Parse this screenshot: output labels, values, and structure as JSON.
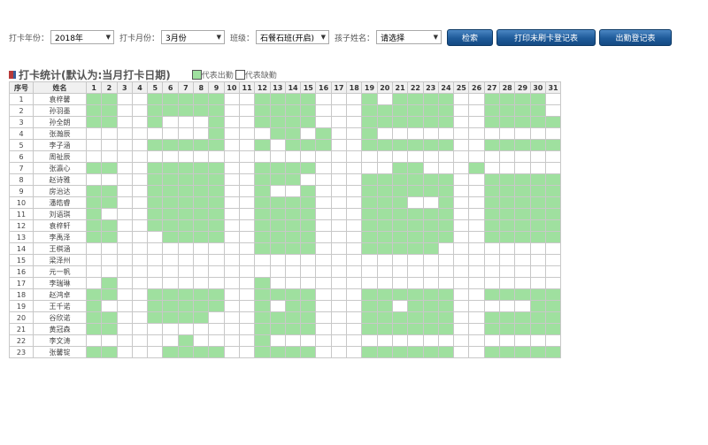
{
  "filters": {
    "year_label": "打卡年份：",
    "year_value": "2018年",
    "month_label": "打卡月份：",
    "month_value": "3月份",
    "class_label": "班级：",
    "class_value": "石餐石班(开启)",
    "child_label": "孩子姓名：",
    "child_value": "请选择"
  },
  "buttons": {
    "search": "检索",
    "print_unpunched": "打印未刷卡登记表",
    "attendance_sheet": "出勤登记表"
  },
  "section": {
    "title": "打卡统计(默认为:当月打卡日期)",
    "legend_present": "代表出勤",
    "legend_absent": "代表缺勤"
  },
  "colors": {
    "present": "#9fe09f",
    "button": "#1e5a99"
  },
  "table": {
    "header_no": "序号",
    "header_name": "姓名",
    "days": [
      "1",
      "2",
      "3",
      "4",
      "5",
      "6",
      "7",
      "8",
      "9",
      "10",
      "11",
      "12",
      "13",
      "14",
      "15",
      "16",
      "17",
      "18",
      "19",
      "20",
      "21",
      "22",
      "23",
      "24",
      "25",
      "26",
      "27",
      "28",
      "29",
      "30",
      "31"
    ],
    "rows": [
      {
        "no": "1",
        "name": "袁梓馨",
        "days": "1100111110011110001011110011110"
      },
      {
        "no": "2",
        "name": "孙羽墨",
        "days": "1100111110011110001111110011110"
      },
      {
        "no": "3",
        "name": "孙全朗",
        "days": "1100100010011110001111110011111"
      },
      {
        "no": "4",
        "name": "张瀚辰",
        "days": "0000000010001101001000000000000"
      },
      {
        "no": "5",
        "name": "李子涵",
        "days": "0000111110010111001111110011111"
      },
      {
        "no": "6",
        "name": "周祉辰",
        "days": "0000000000000000000000000000000"
      },
      {
        "no": "7",
        "name": "张瀛心",
        "days": "1100111110011110000011000100000"
      },
      {
        "no": "8",
        "name": "赵诗雅",
        "days": "0000111110011100001111110011111"
      },
      {
        "no": "9",
        "name": "房治达",
        "days": "1100111110010010001111110011111"
      },
      {
        "no": "10",
        "name": "潘皓睿",
        "days": "1100111110011110001110010011111"
      },
      {
        "no": "11",
        "name": "刘语琪",
        "days": "1000111110011110001111110011111"
      },
      {
        "no": "12",
        "name": "袁梓轩",
        "days": "1100111110011110001111110011111"
      },
      {
        "no": "13",
        "name": "李禹泽",
        "days": "1100011110011110001111110011111"
      },
      {
        "no": "14",
        "name": "王棋涵",
        "days": "0000000000011110001111100000000"
      },
      {
        "no": "15",
        "name": "梁泽州",
        "days": "0000000000000000000000000000000"
      },
      {
        "no": "16",
        "name": "元一帆",
        "days": "0000000000000000000000000000000"
      },
      {
        "no": "17",
        "name": "李瑞琳",
        "days": "0100000000010000000000000000000"
      },
      {
        "no": "18",
        "name": "赵鸿卓",
        "days": "1100111110011110001111110011111"
      },
      {
        "no": "19",
        "name": "王千诺",
        "days": "1000111110010110001101110000011"
      },
      {
        "no": "20",
        "name": "谷欣诺",
        "days": "1100111100011110001111110011111"
      },
      {
        "no": "21",
        "name": "黄冠森",
        "days": "1100000000011110001111110011111"
      },
      {
        "no": "22",
        "name": "李文涛",
        "days": "0000001000010000000000000000000"
      },
      {
        "no": "23",
        "name": "张馨锭",
        "days": "1100011110011110001111110011111"
      }
    ]
  }
}
